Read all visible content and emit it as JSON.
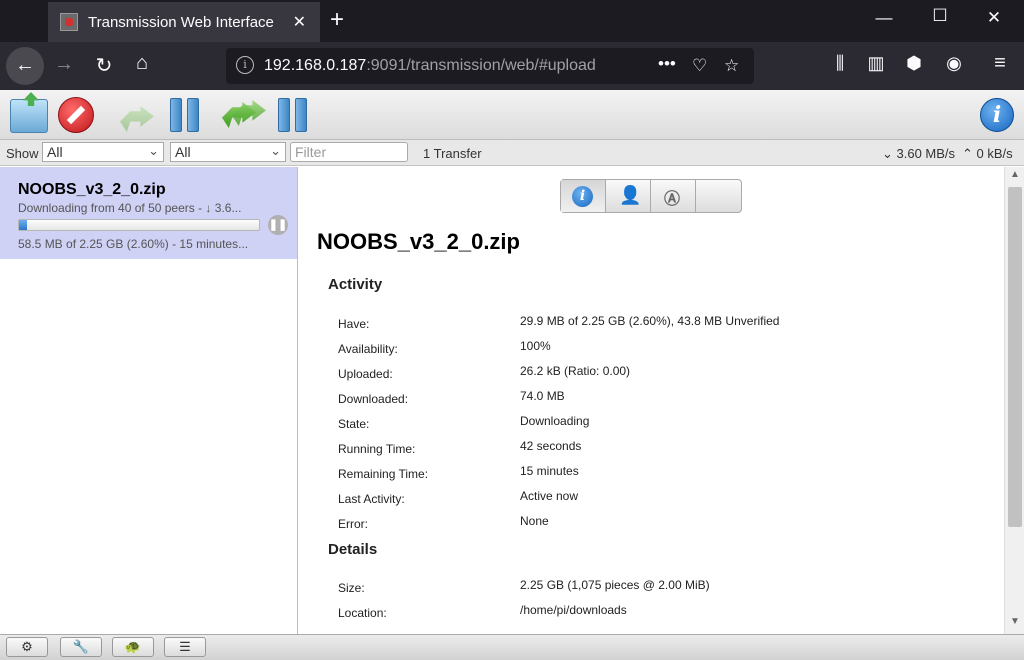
{
  "browser": {
    "tab_title": "Transmission Web Interface",
    "url_host": "192.168.0.187",
    "url_rest": ":9091/transmission/web/#upload"
  },
  "filter": {
    "show_label": "Show",
    "status_select": "All",
    "tracker_select": "All",
    "filter_placeholder": "Filter",
    "transfer_count": "1 Transfer",
    "download_speed": "3.60 MB/s",
    "upload_speed": "0 kB/s"
  },
  "torrent": {
    "name": "NOOBS_v3_2_0.zip",
    "peers_text": "Downloading from 40 of 50 peers - ↓ 3.6...",
    "progress_fraction": 0.026,
    "size_text": "58.5 MB of 2.25 GB (2.60%) - 15 minutes..."
  },
  "inspector": {
    "title": "NOOBS_v3_2_0.zip",
    "activity_title": "Activity",
    "details_title": "Details",
    "activity": [
      {
        "label": "Have:",
        "value": "29.9 MB of 2.25 GB (2.60%), 43.8 MB Unverified"
      },
      {
        "label": "Availability:",
        "value": "100%"
      },
      {
        "label": "Uploaded:",
        "value": "26.2 kB (Ratio: 0.00)"
      },
      {
        "label": "Downloaded:",
        "value": "74.0 MB"
      },
      {
        "label": "State:",
        "value": "Downloading"
      },
      {
        "label": "Running Time:",
        "value": "42 seconds"
      },
      {
        "label": "Remaining Time:",
        "value": "15 minutes"
      },
      {
        "label": "Last Activity:",
        "value": "Active now"
      },
      {
        "label": "Error:",
        "value": "None"
      }
    ],
    "details": [
      {
        "label": "Size:",
        "value": "2.25 GB (1,075 pieces @ 2.00 MiB)"
      },
      {
        "label": "Location:",
        "value": "/home/pi/downloads"
      }
    ]
  },
  "icons": {
    "settings": "⚙",
    "preferences": "🔧",
    "turtle": "🐢",
    "compact": "☰"
  }
}
